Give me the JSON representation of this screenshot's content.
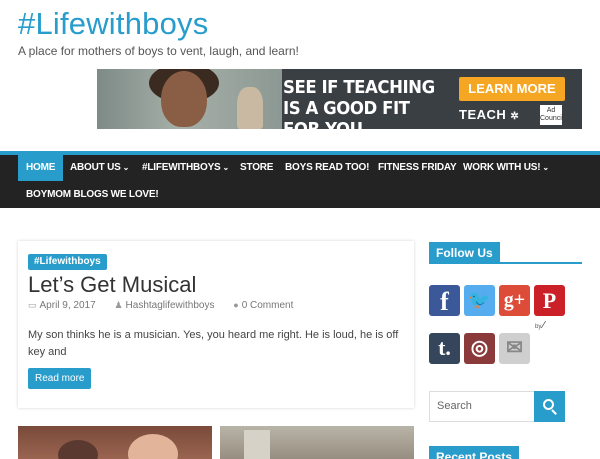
{
  "site": {
    "title": "#Lifewithboys",
    "tagline": "A place for mothers of boys to vent, laugh, and learn!"
  },
  "ad": {
    "headline": "SEE IF TEACHING IS A GOOD FIT FOR YOU",
    "cta": "LEARN MORE",
    "brand": "TEACH",
    "council": "Ad Council"
  },
  "nav": {
    "items": [
      {
        "label": "HOME",
        "active": true,
        "dropdown": false
      },
      {
        "label": "ABOUT US",
        "dropdown": true
      },
      {
        "label": "#LIFEWITHBOYS",
        "dropdown": true
      },
      {
        "label": "STORE",
        "dropdown": false
      },
      {
        "label": "BOYS READ TOO!",
        "dropdown": false
      },
      {
        "label": "FITNESS FRIDAY",
        "dropdown": false
      },
      {
        "label": "WORK WITH US!",
        "dropdown": true
      },
      {
        "label": "BOYMOM BLOGS WE LOVE!",
        "dropdown": false
      }
    ],
    "chevron": "⌄"
  },
  "post": {
    "category": "#Lifewithboys",
    "title": "Let’s Get Musical",
    "date": "April 9, 2017",
    "author": "Hashtaglifewithboys",
    "comments": "0 Comment",
    "excerpt": "My son thinks he is a musician. Yes, you heard me right.  He is loud, he is off key and",
    "read_more": "Read more"
  },
  "sidebar": {
    "follow_title": "Follow Us",
    "social": [
      {
        "name": "facebook-icon",
        "glyph": "f",
        "color": "#3b5998"
      },
      {
        "name": "twitter-icon",
        "glyph": "🐦",
        "color": "#55acee"
      },
      {
        "name": "google-plus-icon",
        "glyph": "g+",
        "color": "#dd4b39"
      },
      {
        "name": "pinterest-icon",
        "glyph": "P",
        "color": "#cb2027"
      },
      {
        "name": "tumblr-icon",
        "glyph": "t.",
        "color": "#35465c"
      },
      {
        "name": "instagram-icon",
        "glyph": "◎",
        "color": "#8a3a3a"
      },
      {
        "name": "email-icon",
        "glyph": "✉",
        "color": "#cfcfcf"
      }
    ],
    "by": "by",
    "search_placeholder": "Search",
    "recent_title": "Recent Posts"
  },
  "colors": {
    "accent": "#289dcc",
    "nav_bg": "#232323"
  }
}
